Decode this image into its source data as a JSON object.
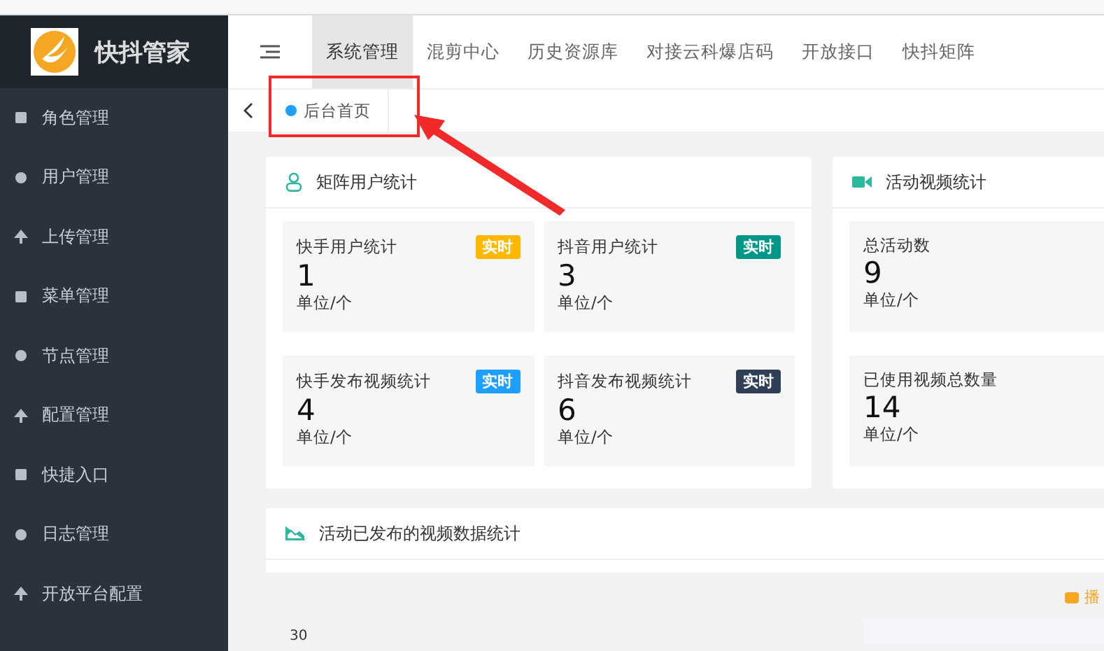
{
  "logo": {
    "title": "快抖管家"
  },
  "sidebar": {
    "items": [
      {
        "label": "角色管理"
      },
      {
        "label": "用户管理"
      },
      {
        "label": "上传管理"
      },
      {
        "label": "菜单管理"
      },
      {
        "label": "节点管理"
      },
      {
        "label": "配置管理"
      },
      {
        "label": "快捷入口"
      },
      {
        "label": "日志管理"
      },
      {
        "label": "开放平台配置"
      }
    ]
  },
  "top_nav": {
    "tabs": [
      {
        "label": "系统管理",
        "selected": true
      },
      {
        "label": "混剪中心",
        "selected": false
      },
      {
        "label": "历史资源库",
        "selected": false
      },
      {
        "label": "对接云科爆店码",
        "selected": false
      },
      {
        "label": "开放接口",
        "selected": false
      },
      {
        "label": "快抖矩阵",
        "selected": false
      }
    ]
  },
  "page_tabs": [
    {
      "label": "后台首页",
      "selected": true
    }
  ],
  "panels": [
    {
      "title": "矩阵用户统计",
      "kind": "user",
      "tiles": [
        {
          "label": "快手用户统计",
          "value": "1",
          "unit": "单位/个",
          "badge": "实时",
          "color": "#ffb800"
        },
        {
          "label": "抖音用户统计",
          "value": "3",
          "unit": "单位/个",
          "badge": "实时",
          "color": "#009688"
        },
        {
          "label": "快手发布视频统计",
          "value": "4",
          "unit": "单位/个",
          "badge": "实时",
          "color": "#1e9fff"
        },
        {
          "label": "抖音发布视频统计",
          "value": "6",
          "unit": "单位/个",
          "badge": "实时",
          "color": "#2f4056"
        }
      ]
    },
    {
      "title": "活动视频统计",
      "kind": "video",
      "tiles": [
        {
          "label": "总活动数",
          "value": "9",
          "unit": "单位/个"
        },
        {
          "label": "已使用视频总数量",
          "value": "14",
          "unit": "单位/个"
        }
      ]
    }
  ],
  "chart_panel": {
    "title": "活动已发布的视频数据统计",
    "legend": [
      {
        "label": "播",
        "color": "#f5a623"
      }
    ],
    "y_tick": "30"
  }
}
